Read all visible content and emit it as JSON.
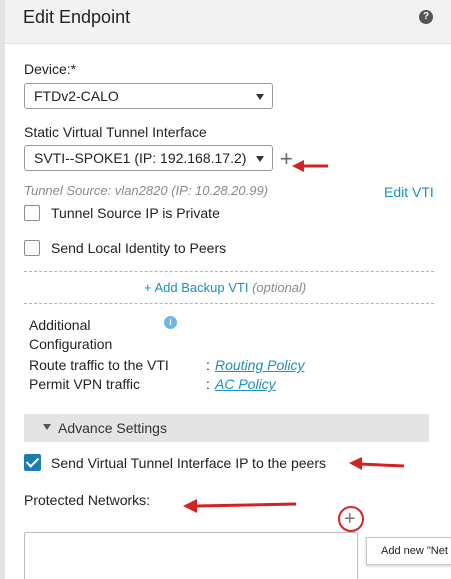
{
  "dialog": {
    "title": "Edit Endpoint",
    "help_icon": "question-circle-icon"
  },
  "device": {
    "label": "Device:*",
    "selected": "FTDv2-CALO"
  },
  "svti": {
    "label": "Static Virtual Tunnel Interface",
    "selected": "SVTI--SPOKE1 (IP: 192.168.17.2)",
    "tunnel_source": "Tunnel Source: vlan2820 (IP: 10.28.20.99)",
    "edit_vti_label": "Edit VTI"
  },
  "checkboxes": {
    "tunnel_source_private": {
      "label": "Tunnel Source IP is Private",
      "checked": false
    },
    "send_local_identity": {
      "label": "Send Local Identity to Peers",
      "checked": false
    },
    "send_vti_ip": {
      "label": "Send Virtual Tunnel Interface IP to the peers",
      "checked": true
    }
  },
  "backup": {
    "link_label": "+ Add Backup VTI",
    "optional_label": "(optional)"
  },
  "additional": {
    "label_line1": "Additional",
    "label_line2": "Configuration",
    "info_icon": "info-icon",
    "route_label": "Route traffic to the VTI",
    "route_link": "Routing Policy",
    "permit_label": "Permit VPN traffic",
    "permit_link": "AC Policy",
    "colon": ":"
  },
  "advance": {
    "label": "Advance Settings"
  },
  "protected": {
    "label": "Protected Networks:",
    "add_new_popup": "Add new \"Net"
  },
  "colors": {
    "link": "#1b8fbf",
    "checkbox_checked": "#1d7db0",
    "annotation_red": "#d22222"
  }
}
